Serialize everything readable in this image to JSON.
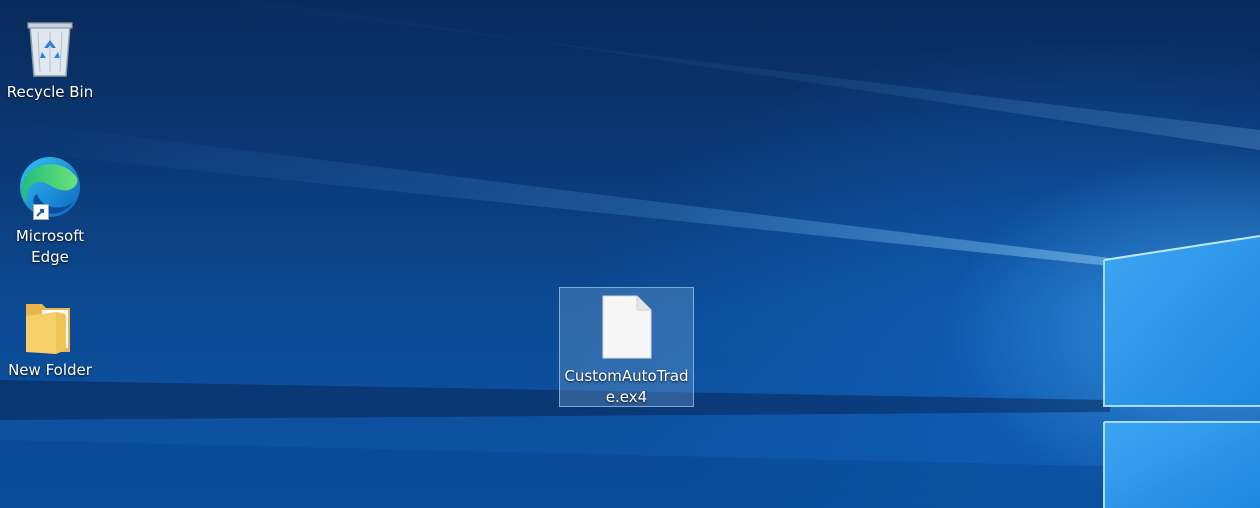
{
  "desktop": {
    "wallpaper": "windows-10-hero-light-beams",
    "colors": {
      "background_dark": "#0a2a5c",
      "background_light": "#1f8de6",
      "window_glow": "#7fd0ff",
      "selection_fill": "#78aadc",
      "label_text": "#ffffff"
    },
    "icons": [
      {
        "label": "Recycle Bin",
        "icon": "recycle-bin-icon",
        "selected": false
      },
      {
        "label": "Microsoft Edge",
        "icon": "edge-icon",
        "shortcut": true,
        "selected": false
      },
      {
        "label": "New Folder",
        "icon": "folder-icon",
        "selected": false
      },
      {
        "label": "CustomAutoTrade.ex4",
        "icon": "blank-file-icon",
        "selected": true
      }
    ]
  }
}
